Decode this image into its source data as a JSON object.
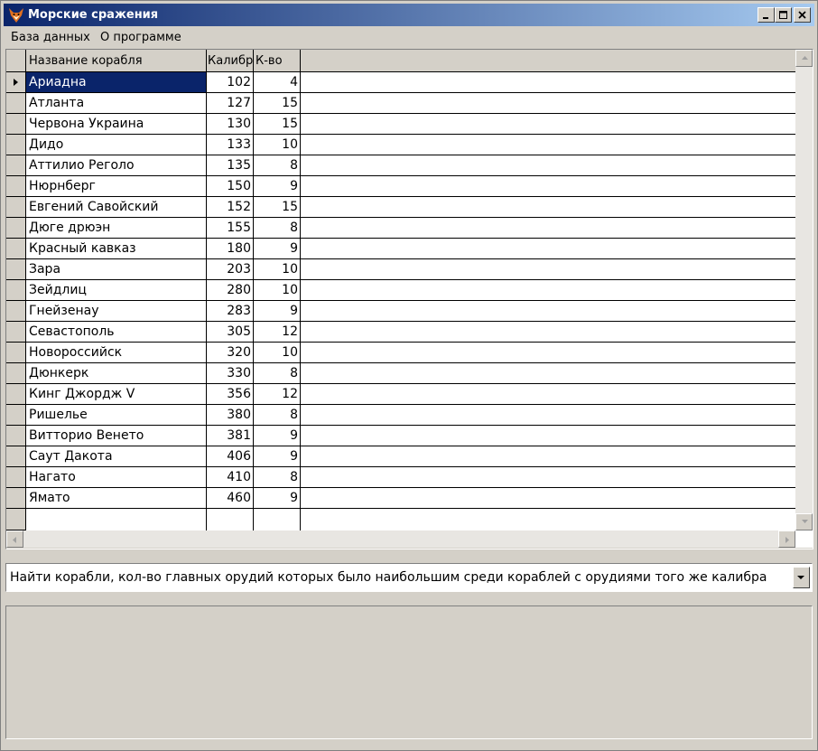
{
  "window": {
    "title": "Морские сражения",
    "title_gradient_start": "#0a246a",
    "title_gradient_end": "#a6caf0",
    "icon": "fox-app-icon"
  },
  "menu": {
    "items": [
      "База данных",
      "О программе"
    ]
  },
  "grid": {
    "columns": [
      "Название корабля",
      "Калибр",
      "К-во"
    ],
    "selected_row_color": "#0a246a",
    "rows": [
      {
        "name": "Ариадна",
        "caliber": "102",
        "count": "4"
      },
      {
        "name": "Атланта",
        "caliber": "127",
        "count": "15"
      },
      {
        "name": "Червона Украина",
        "caliber": "130",
        "count": "15"
      },
      {
        "name": "Дидо",
        "caliber": "133",
        "count": "10"
      },
      {
        "name": "Аттилио Реголо",
        "caliber": "135",
        "count": "8"
      },
      {
        "name": "Нюрнберг",
        "caliber": "150",
        "count": "9"
      },
      {
        "name": "Евгений Савойский",
        "caliber": "152",
        "count": "15"
      },
      {
        "name": "Дюге дрюэн",
        "caliber": "155",
        "count": "8"
      },
      {
        "name": "Красный кавказ",
        "caliber": "180",
        "count": "9"
      },
      {
        "name": "Зара",
        "caliber": "203",
        "count": "10"
      },
      {
        "name": "Зейдлиц",
        "caliber": "280",
        "count": "10"
      },
      {
        "name": "Гнейзенау",
        "caliber": "283",
        "count": "9"
      },
      {
        "name": "Севастополь",
        "caliber": "305",
        "count": "12"
      },
      {
        "name": "Новороссийск",
        "caliber": "320",
        "count": "10"
      },
      {
        "name": "Дюнкерк",
        "caliber": "330",
        "count": "8"
      },
      {
        "name": "Кинг Джордж V",
        "caliber": "356",
        "count": "12"
      },
      {
        "name": "Ришелье",
        "caliber": "380",
        "count": "8"
      },
      {
        "name": "Витторио Венето",
        "caliber": "381",
        "count": "9"
      },
      {
        "name": "Саут Дакота",
        "caliber": "406",
        "count": "9"
      },
      {
        "name": "Нагато",
        "caliber": "410",
        "count": "8"
      },
      {
        "name": "Ямато",
        "caliber": "460",
        "count": "9"
      }
    ]
  },
  "query_select": {
    "selected": "Найти корабли, кол-во главных орудий которых было наибольшим среди кораблей с орудиями того же калибра"
  }
}
